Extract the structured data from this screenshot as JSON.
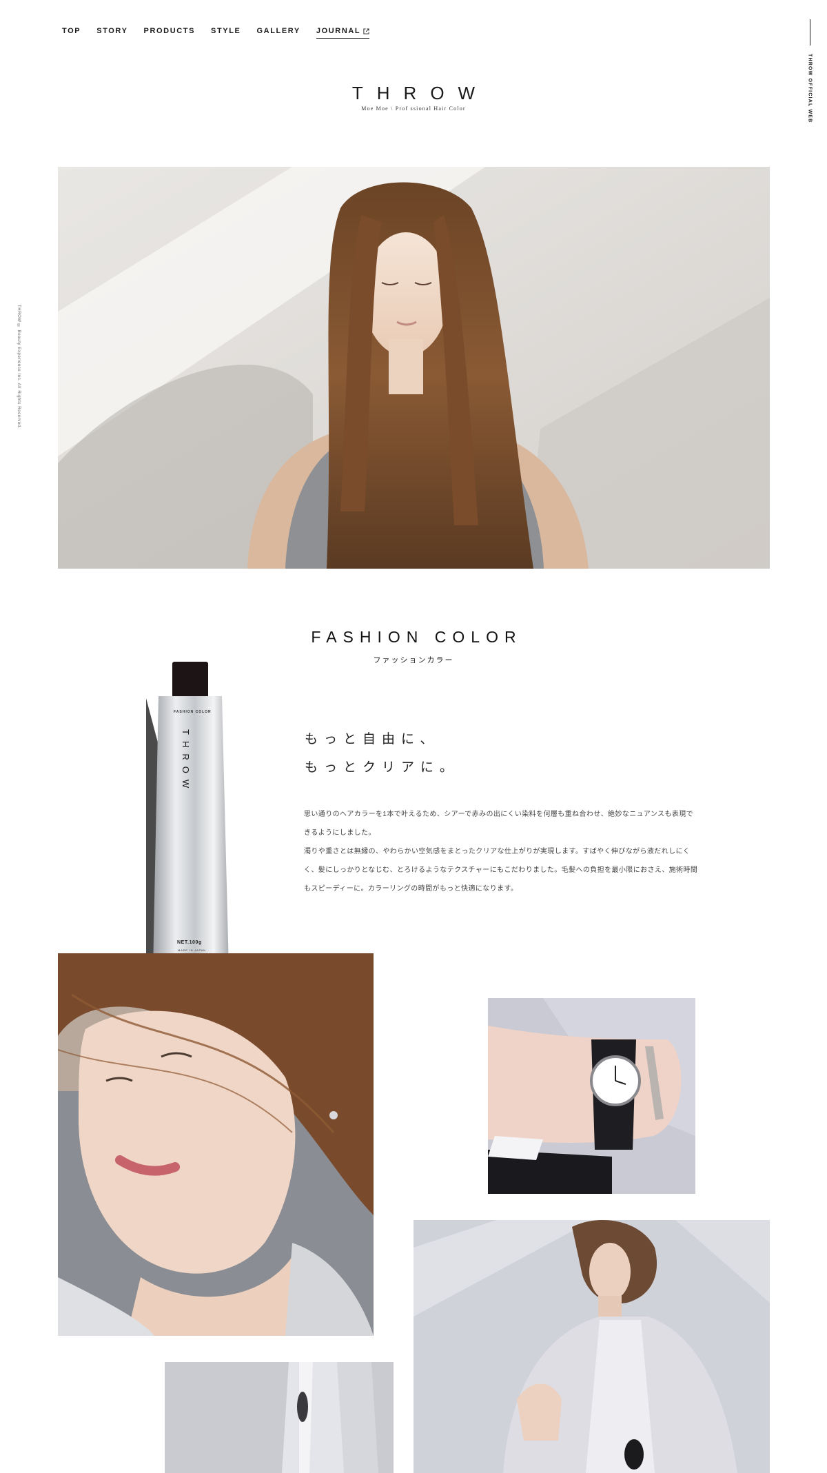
{
  "nav": {
    "items": [
      {
        "label": "TOP"
      },
      {
        "label": "STORY"
      },
      {
        "label": "PRODUCTS"
      },
      {
        "label": "STYLE"
      },
      {
        "label": "GALLERY"
      },
      {
        "label": "JOURNAL"
      }
    ]
  },
  "side": {
    "right_label": "THROW OFFICIAL WEB",
    "left_copyright": "THROW © Beauty Experience Inc. All Rights Reserved."
  },
  "logo": {
    "mark": "THROW",
    "tagline": "Moe Moe \\ Prof ssional Hair Color"
  },
  "fashion": {
    "title_en": "FASHION COLOR",
    "title_jp": "ファッションカラー",
    "headline": [
      "もっと自由に、",
      "もっとクリアに。"
    ],
    "body": [
      "思い通りのヘアカラーを1本で叶えるため、シアーで赤みの出にくい染料を何層も重ね合わせ、絶妙なニュアンスも表現できるようにしました。",
      "濁りや重さとは無縁の、やわらかい空気感をまとったクリアな仕上がりが実現します。すばやく伸びながら液だれしにくく、髪にしっかりとなじむ、とろけるようなテクスチャーにもこだわりました。毛髪への負担を最小限におさえ、施術時間もスピーディーに。カラーリングの時間がもっと快適になります。"
    ],
    "tube": {
      "brand": "THROW",
      "top_label": "FASHION COLOR",
      "net": "NET.100g",
      "made": "MADE IN JAPAN"
    }
  },
  "colors": {
    "text": "#1a1a1a",
    "background": "#ffffff"
  }
}
